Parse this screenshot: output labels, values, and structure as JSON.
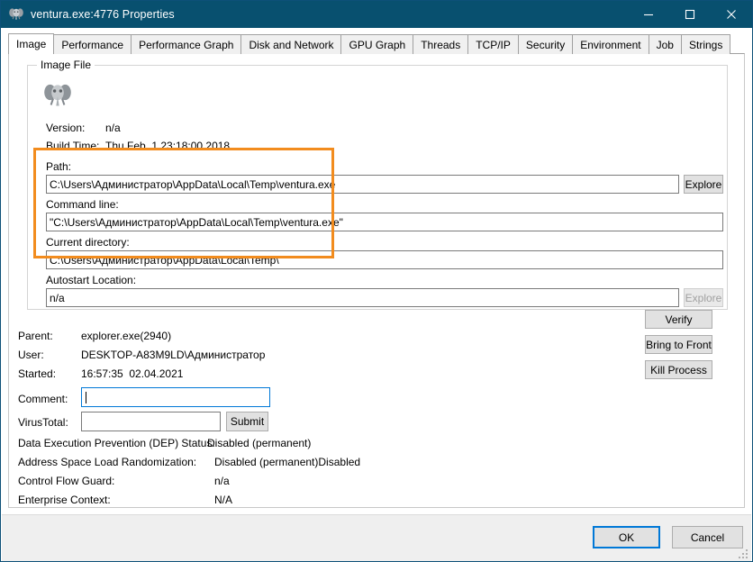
{
  "window": {
    "title": "ventura.exe:4776 Properties",
    "icon": "elephant-icon",
    "minimize_label": "minimize-icon",
    "maximize_label": "maximize-icon",
    "close_label": "close-icon",
    "titlebar_color": "#08506f"
  },
  "tabs": [
    {
      "label": "Image",
      "active": true
    },
    {
      "label": "Performance",
      "active": false
    },
    {
      "label": "Performance Graph",
      "active": false
    },
    {
      "label": "Disk and Network",
      "active": false
    },
    {
      "label": "GPU Graph",
      "active": false
    },
    {
      "label": "Threads",
      "active": false
    },
    {
      "label": "TCP/IP",
      "active": false
    },
    {
      "label": "Security",
      "active": false
    },
    {
      "label": "Environment",
      "active": false
    },
    {
      "label": "Job",
      "active": false
    },
    {
      "label": "Strings",
      "active": false
    }
  ],
  "image_file": {
    "group_label": "Image File",
    "version_label": "Version:",
    "version_value": "n/a",
    "build_time_label": "Build Time:",
    "build_time_value": "Thu Feb  1 23:18:00 2018",
    "path_label": "Path:",
    "path_value": "C:\\Users\\Администратор\\AppData\\Local\\Temp\\ventura.exe",
    "path_explore_label": "Explore",
    "command_line_label": "Command line:",
    "command_line_value": "\"C:\\Users\\Администратор\\AppData\\Local\\Temp\\ventura.exe\"",
    "current_directory_label": "Current directory:",
    "current_directory_value": "C:\\Users\\Администратор\\AppData\\Local\\Temp\\",
    "autostart_label": "Autostart Location:",
    "autostart_value": "n/a",
    "autostart_explore_label": "Explore"
  },
  "highlight": {
    "color": "#f28c1e",
    "covers": "path-command-line-current-directory"
  },
  "process_info": {
    "parent_label": "Parent:",
    "parent_value": "explorer.exe(2940)",
    "user_label": "User:",
    "user_value": "DESKTOP-A83M9LD\\Администратор",
    "started_label": "Started:",
    "started_value": "16:57:35  02.04.2021",
    "comment_label": "Comment:",
    "comment_value": "",
    "virustotal_label": "VirusTotal:",
    "virustotal_value": "",
    "submit_label": "Submit"
  },
  "mitigations": [
    {
      "label": "Data Execution Prevention (DEP) Status:",
      "value": "Disabled (permanent)"
    },
    {
      "label": "Address Space Load Randomization:",
      "value": "Disabled (permanent)Disabled"
    },
    {
      "label": "Control Flow Guard:",
      "value": "n/a"
    },
    {
      "label": "Enterprise Context:",
      "value": "N/A"
    }
  ],
  "action_buttons": [
    {
      "label": "Verify"
    },
    {
      "label": "Bring to Front"
    },
    {
      "label": "Kill Process"
    }
  ],
  "footer": {
    "ok_label": "OK",
    "cancel_label": "Cancel",
    "ok_is_default": true
  }
}
